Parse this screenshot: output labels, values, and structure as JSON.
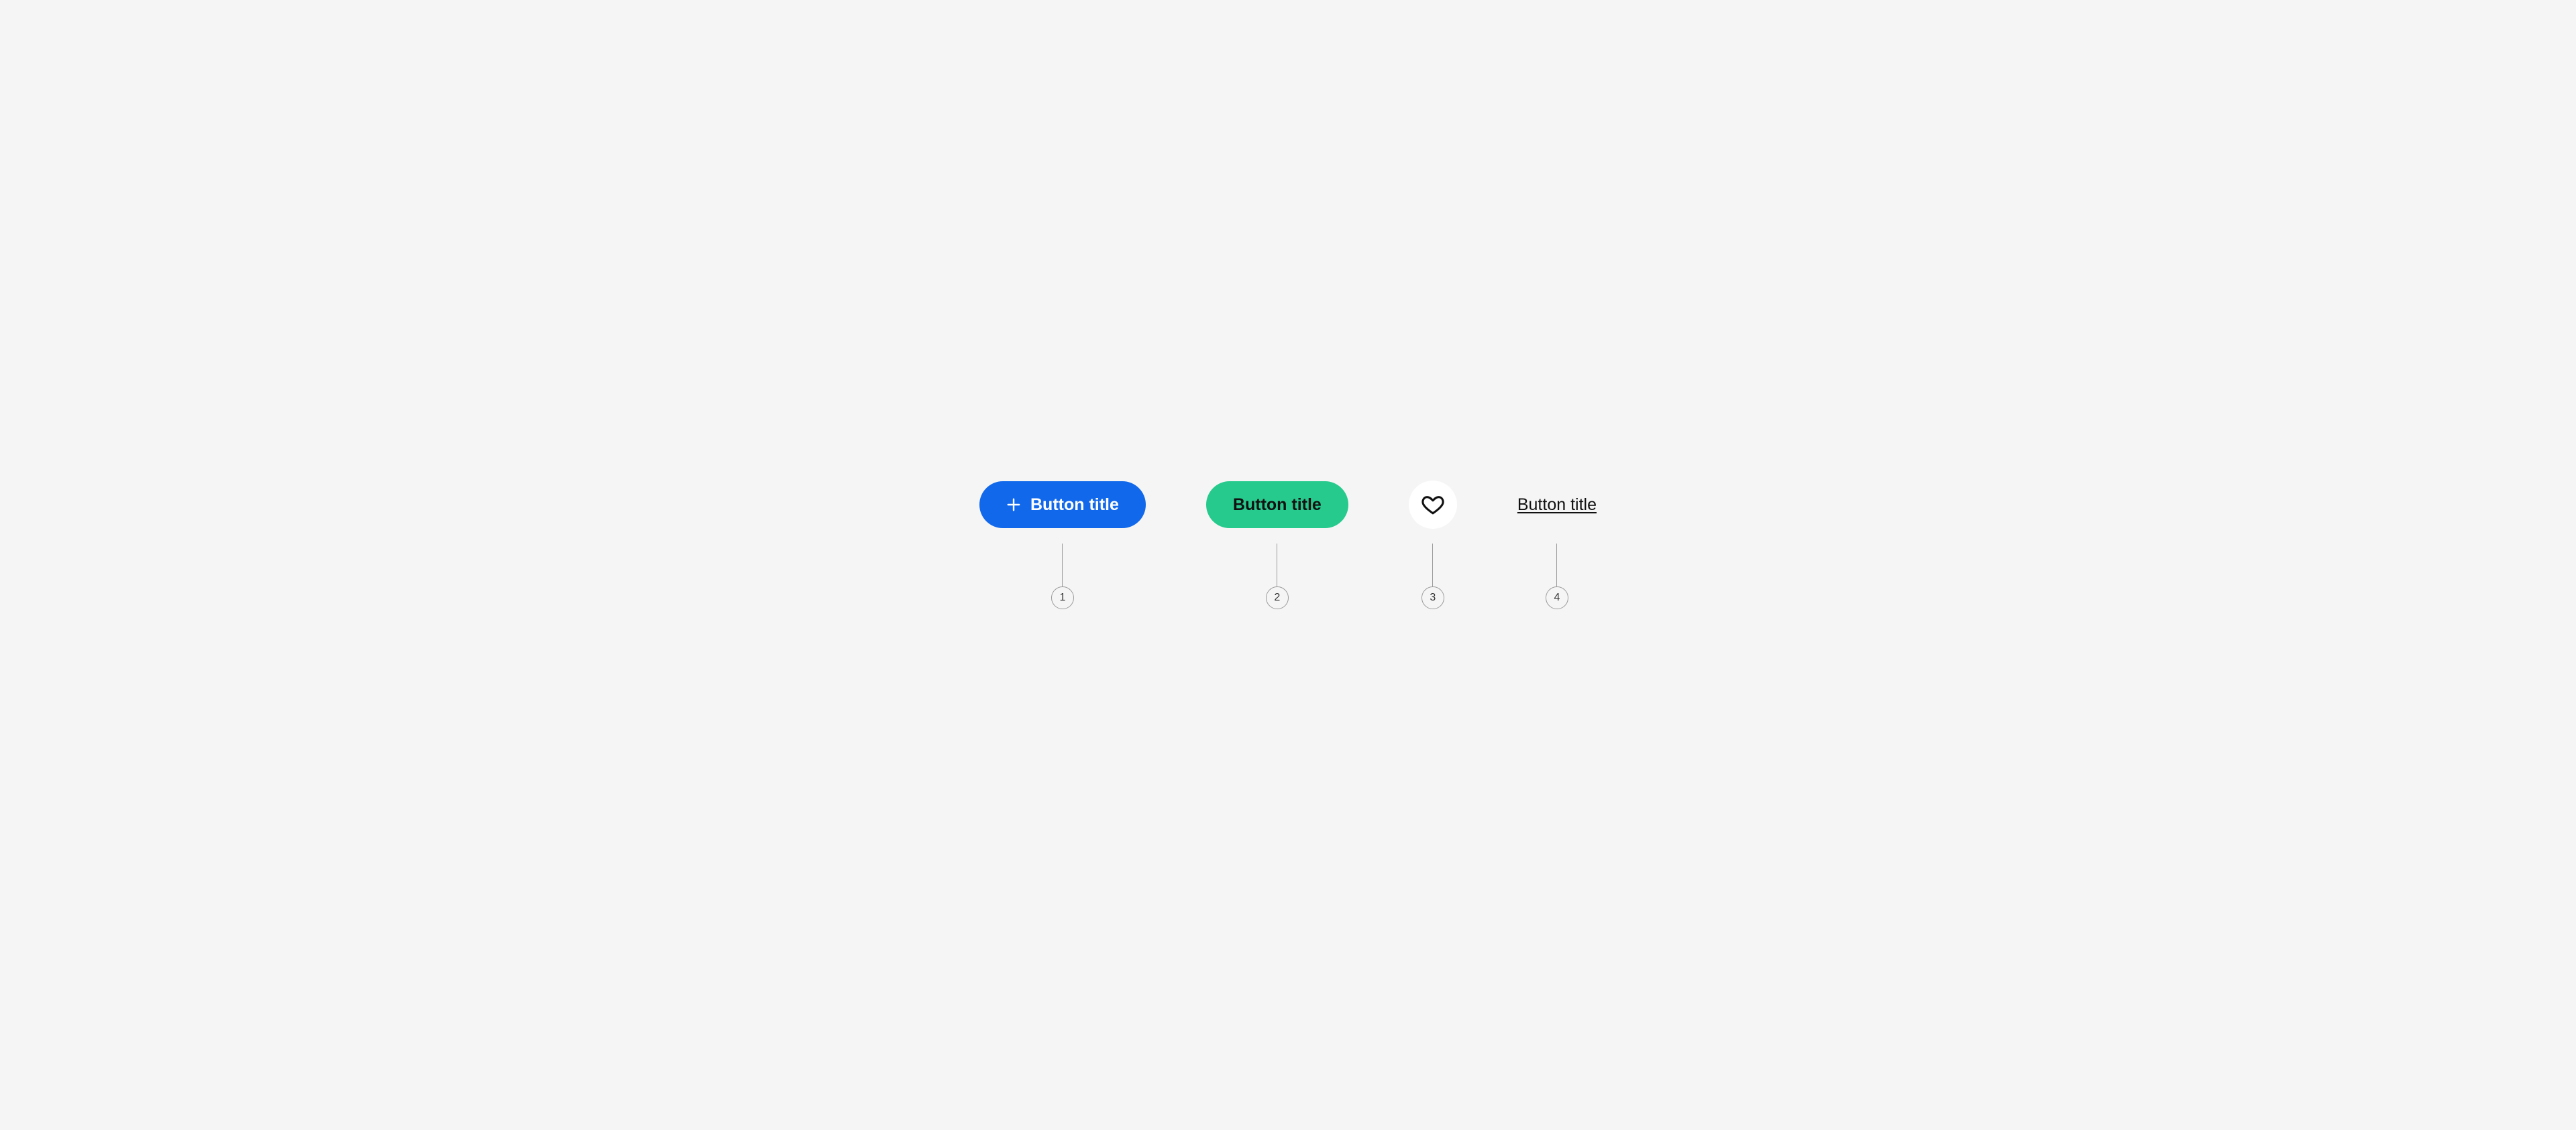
{
  "buttons": {
    "primary": {
      "label": "Button title"
    },
    "secondary": {
      "label": "Button title"
    },
    "link": {
      "label": "Button title"
    }
  },
  "annotations": {
    "one": "1",
    "two": "2",
    "three": "3",
    "four": "4"
  },
  "colors": {
    "primary": "#1168eb",
    "secondary": "#27ca8d",
    "surface": "#ffffff",
    "background": "#f5f5f5",
    "text": "#111111"
  }
}
